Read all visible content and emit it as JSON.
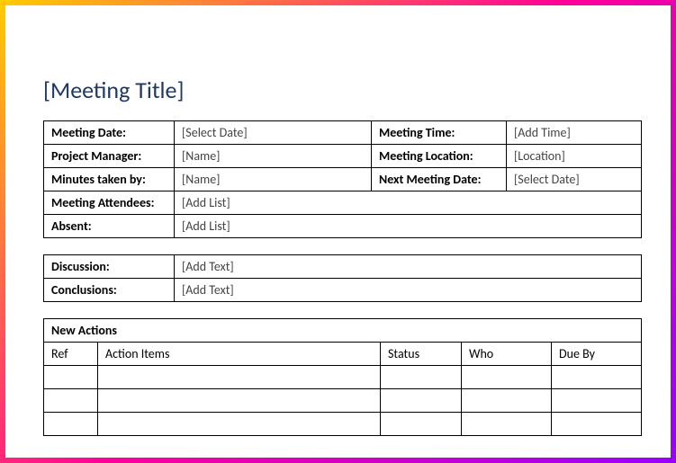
{
  "title": "[Meeting Title]",
  "meta": {
    "meetingDate": {
      "label": "Meeting Date:",
      "value": "[Select Date]"
    },
    "meetingTime": {
      "label": "Meeting Time:",
      "value": "[Add Time]"
    },
    "projectManager": {
      "label": "Project Manager:",
      "value": "[Name]"
    },
    "meetingLocation": {
      "label": "Meeting Location:",
      "value": "[Location]"
    },
    "minutesTakenBy": {
      "label": "Minutes taken by:",
      "value": "[Name]"
    },
    "nextMeetingDate": {
      "label": "Next Meeting Date:",
      "value": "[Select Date]"
    },
    "meetingAttendees": {
      "label": "Meeting Attendees:",
      "value": "[Add List]"
    },
    "absent": {
      "label": "Absent:",
      "value": "[Add List]"
    }
  },
  "notes": {
    "discussion": {
      "label": "Discussion:",
      "value": "[Add Text]"
    },
    "conclusions": {
      "label": "Conclusions:",
      "value": "[Add Text]"
    }
  },
  "actions": {
    "heading": "New Actions",
    "columns": {
      "ref": "Ref",
      "item": "Action Items",
      "status": "Status",
      "who": "Who",
      "dueBy": "Due By"
    }
  }
}
